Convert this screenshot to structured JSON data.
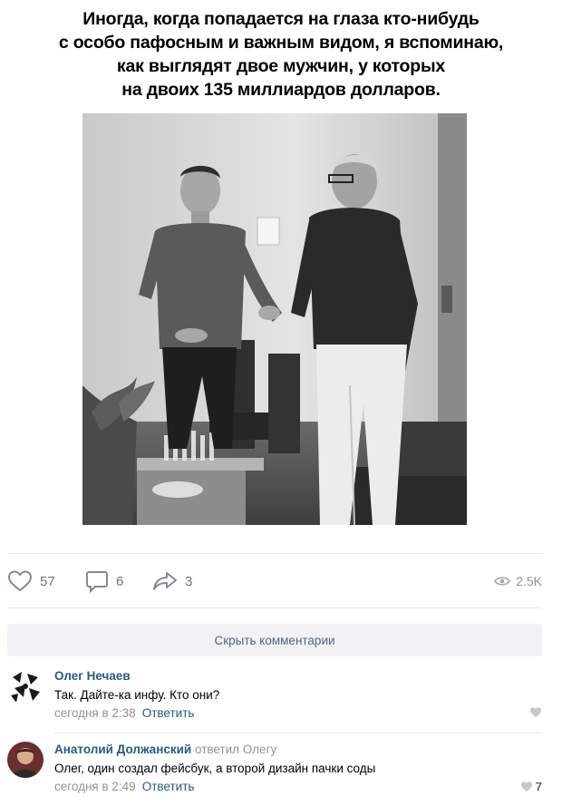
{
  "post": {
    "caption_lines": [
      "Иногда, когда попадается на глаза кто-нибудь",
      "с особо пафосным и важным видом, я вспоминаю,",
      "как выглядят двое мужчин, у которых",
      "на двоих 135 миллиардов долларов."
    ]
  },
  "actions": {
    "likes": "57",
    "comments": "6",
    "shares": "3",
    "views": "2.5K",
    "icons": {
      "like": "heart-outline-icon",
      "comment": "speech-bubble-icon",
      "share": "share-arrow-icon",
      "views": "eye-icon"
    }
  },
  "comments_toggle": {
    "label": "Скрыть комментарии"
  },
  "comments": [
    {
      "author": "Олег Нечаев",
      "text": "Так. Дайте-ка инфу. Кто они?",
      "time": "сегодня в 2:38",
      "reply_label": "Ответить",
      "likes": ""
    },
    {
      "author": "Анатолий Должанский",
      "replied_text": "ответил",
      "replied_to": "Олегу",
      "text": "Олег, один создал фейсбук, а второй дизайн пачки соды",
      "time": "сегодня в 2:49",
      "reply_label": "Ответить",
      "likes": "7"
    }
  ],
  "colors": {
    "link": "#2a5885",
    "muted": "#939393",
    "button_bg": "#f0f2f5",
    "divider": "#e7e8ec"
  }
}
